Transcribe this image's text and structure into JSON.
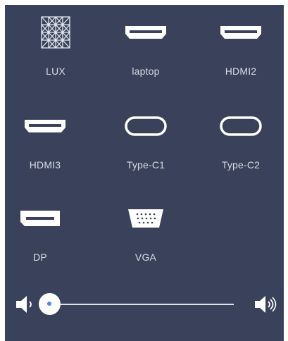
{
  "sources": [
    {
      "label": "LUX",
      "icon": "lux-logo-icon"
    },
    {
      "label": "laptop",
      "icon": "hdmi-port-icon"
    },
    {
      "label": "HDMI2",
      "icon": "hdmi-port-icon"
    },
    {
      "label": "HDMI3",
      "icon": "hdmi-port-icon"
    },
    {
      "label": "Type-C1",
      "icon": "usb-c-port-icon"
    },
    {
      "label": "Type-C2",
      "icon": "usb-c-port-icon"
    },
    {
      "label": "DP",
      "icon": "displayport-icon"
    },
    {
      "label": "VGA",
      "icon": "vga-port-icon"
    }
  ],
  "volume": {
    "level": 0.0,
    "mute_icon": "speaker-low-icon",
    "max_icon": "speaker-high-icon"
  },
  "colors": {
    "panel_background": "#39425a",
    "icon_white": "#ffffff",
    "label_text": "#d9dce4",
    "slider_dot": "#4a8ee0"
  }
}
